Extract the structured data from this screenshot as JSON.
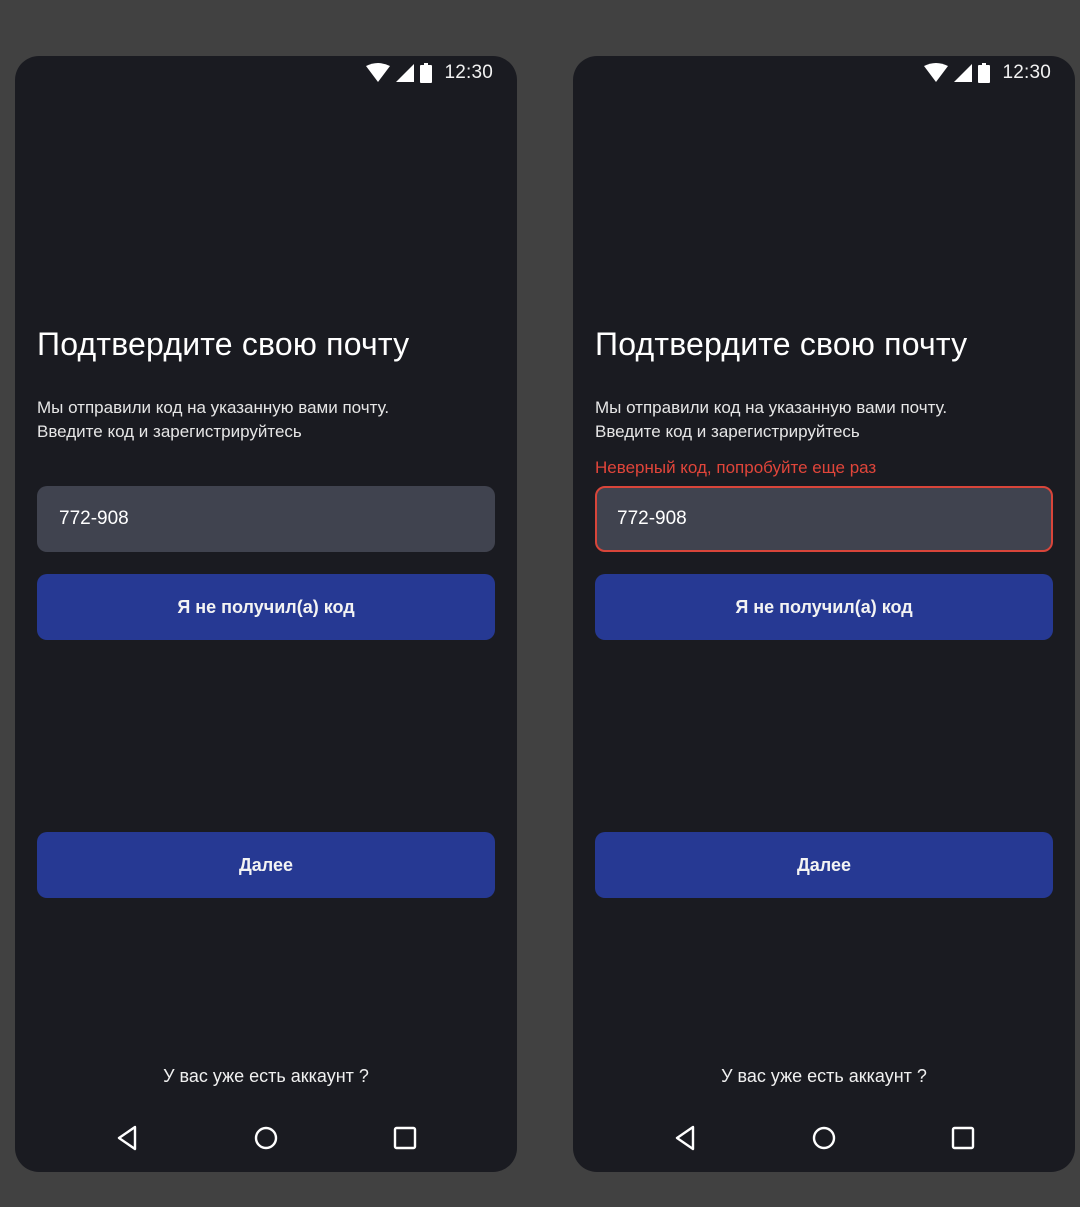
{
  "screens": [
    {
      "state": "default",
      "status_bar": {
        "time": "12:30",
        "icons": [
          "wifi-icon",
          "cellular-signal-icon",
          "battery-icon"
        ]
      },
      "title": "Подтвердите свою почту",
      "subtitle_line1": "Мы отправили код  на указанную вами почту.",
      "subtitle_line2": "Введите код и зарегистрируйтесь",
      "code_value": "772-908",
      "resend_button": "Я не получил(а) код",
      "next_button": "Далее",
      "account_link": "У вас уже есть аккаунт ?",
      "nav": [
        "back-icon",
        "home-icon",
        "recents-icon"
      ]
    },
    {
      "state": "error",
      "status_bar": {
        "time": "12:30",
        "icons": [
          "wifi-icon",
          "cellular-signal-icon",
          "battery-icon"
        ]
      },
      "title": "Подтвердите свою почту",
      "subtitle_line1": "Мы отправили код  на указанную вами почту.",
      "subtitle_line2": "Введите код и зарегистрируйтесь",
      "error_text": "Неверный код, попробуйте еще раз",
      "code_value": "772-908",
      "resend_button": "Я не получил(а) код",
      "next_button": "Далее",
      "account_link": "У вас уже есть аккаунт ?",
      "nav": [
        "back-icon",
        "home-icon",
        "recents-icon"
      ]
    }
  ],
  "colors": {
    "page_background": "#414141",
    "screen_background": "#1a1b21",
    "input_background": "#40434f",
    "button_primary": "#263993",
    "error": "#e0453a",
    "text_primary": "#ffffff"
  }
}
